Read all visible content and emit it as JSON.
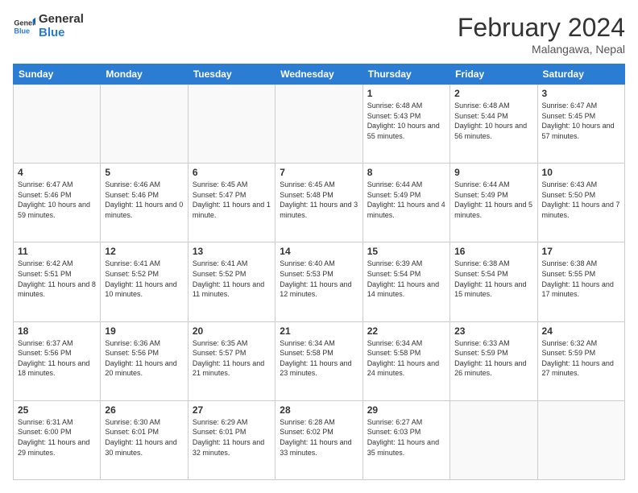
{
  "header": {
    "logo_line1": "General",
    "logo_line2": "Blue",
    "title": "February 2024",
    "subtitle": "Malangawa, Nepal"
  },
  "weekdays": [
    "Sunday",
    "Monday",
    "Tuesday",
    "Wednesday",
    "Thursday",
    "Friday",
    "Saturday"
  ],
  "weeks": [
    [
      {
        "day": "",
        "info": ""
      },
      {
        "day": "",
        "info": ""
      },
      {
        "day": "",
        "info": ""
      },
      {
        "day": "",
        "info": ""
      },
      {
        "day": "1",
        "info": "Sunrise: 6:48 AM\nSunset: 5:43 PM\nDaylight: 10 hours and 55 minutes."
      },
      {
        "day": "2",
        "info": "Sunrise: 6:48 AM\nSunset: 5:44 PM\nDaylight: 10 hours and 56 minutes."
      },
      {
        "day": "3",
        "info": "Sunrise: 6:47 AM\nSunset: 5:45 PM\nDaylight: 10 hours and 57 minutes."
      }
    ],
    [
      {
        "day": "4",
        "info": "Sunrise: 6:47 AM\nSunset: 5:46 PM\nDaylight: 10 hours and 59 minutes."
      },
      {
        "day": "5",
        "info": "Sunrise: 6:46 AM\nSunset: 5:46 PM\nDaylight: 11 hours and 0 minutes."
      },
      {
        "day": "6",
        "info": "Sunrise: 6:45 AM\nSunset: 5:47 PM\nDaylight: 11 hours and 1 minute."
      },
      {
        "day": "7",
        "info": "Sunrise: 6:45 AM\nSunset: 5:48 PM\nDaylight: 11 hours and 3 minutes."
      },
      {
        "day": "8",
        "info": "Sunrise: 6:44 AM\nSunset: 5:49 PM\nDaylight: 11 hours and 4 minutes."
      },
      {
        "day": "9",
        "info": "Sunrise: 6:44 AM\nSunset: 5:49 PM\nDaylight: 11 hours and 5 minutes."
      },
      {
        "day": "10",
        "info": "Sunrise: 6:43 AM\nSunset: 5:50 PM\nDaylight: 11 hours and 7 minutes."
      }
    ],
    [
      {
        "day": "11",
        "info": "Sunrise: 6:42 AM\nSunset: 5:51 PM\nDaylight: 11 hours and 8 minutes."
      },
      {
        "day": "12",
        "info": "Sunrise: 6:41 AM\nSunset: 5:52 PM\nDaylight: 11 hours and 10 minutes."
      },
      {
        "day": "13",
        "info": "Sunrise: 6:41 AM\nSunset: 5:52 PM\nDaylight: 11 hours and 11 minutes."
      },
      {
        "day": "14",
        "info": "Sunrise: 6:40 AM\nSunset: 5:53 PM\nDaylight: 11 hours and 12 minutes."
      },
      {
        "day": "15",
        "info": "Sunrise: 6:39 AM\nSunset: 5:54 PM\nDaylight: 11 hours and 14 minutes."
      },
      {
        "day": "16",
        "info": "Sunrise: 6:38 AM\nSunset: 5:54 PM\nDaylight: 11 hours and 15 minutes."
      },
      {
        "day": "17",
        "info": "Sunrise: 6:38 AM\nSunset: 5:55 PM\nDaylight: 11 hours and 17 minutes."
      }
    ],
    [
      {
        "day": "18",
        "info": "Sunrise: 6:37 AM\nSunset: 5:56 PM\nDaylight: 11 hours and 18 minutes."
      },
      {
        "day": "19",
        "info": "Sunrise: 6:36 AM\nSunset: 5:56 PM\nDaylight: 11 hours and 20 minutes."
      },
      {
        "day": "20",
        "info": "Sunrise: 6:35 AM\nSunset: 5:57 PM\nDaylight: 11 hours and 21 minutes."
      },
      {
        "day": "21",
        "info": "Sunrise: 6:34 AM\nSunset: 5:58 PM\nDaylight: 11 hours and 23 minutes."
      },
      {
        "day": "22",
        "info": "Sunrise: 6:34 AM\nSunset: 5:58 PM\nDaylight: 11 hours and 24 minutes."
      },
      {
        "day": "23",
        "info": "Sunrise: 6:33 AM\nSunset: 5:59 PM\nDaylight: 11 hours and 26 minutes."
      },
      {
        "day": "24",
        "info": "Sunrise: 6:32 AM\nSunset: 5:59 PM\nDaylight: 11 hours and 27 minutes."
      }
    ],
    [
      {
        "day": "25",
        "info": "Sunrise: 6:31 AM\nSunset: 6:00 PM\nDaylight: 11 hours and 29 minutes."
      },
      {
        "day": "26",
        "info": "Sunrise: 6:30 AM\nSunset: 6:01 PM\nDaylight: 11 hours and 30 minutes."
      },
      {
        "day": "27",
        "info": "Sunrise: 6:29 AM\nSunset: 6:01 PM\nDaylight: 11 hours and 32 minutes."
      },
      {
        "day": "28",
        "info": "Sunrise: 6:28 AM\nSunset: 6:02 PM\nDaylight: 11 hours and 33 minutes."
      },
      {
        "day": "29",
        "info": "Sunrise: 6:27 AM\nSunset: 6:03 PM\nDaylight: 11 hours and 35 minutes."
      },
      {
        "day": "",
        "info": ""
      },
      {
        "day": "",
        "info": ""
      }
    ]
  ]
}
